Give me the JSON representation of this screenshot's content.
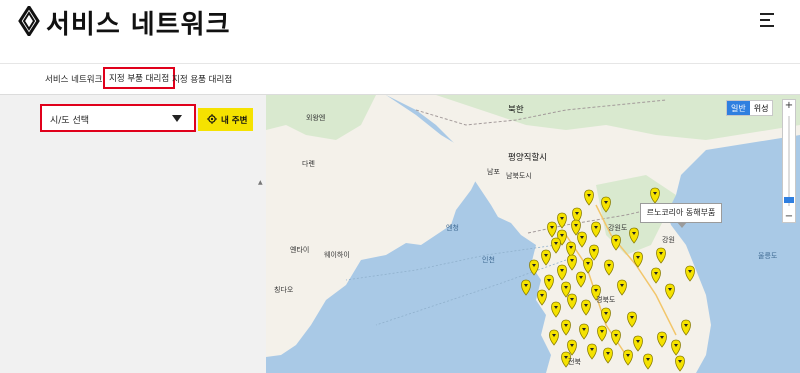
{
  "header": {
    "title": "서비스 네트워크"
  },
  "tabs": [
    {
      "label": "서비스 네트워크"
    },
    {
      "label": "지정 부품 대리점"
    },
    {
      "label": "지정 용품 대리점"
    }
  ],
  "sidebar": {
    "select_placeholder": "시/도 선택",
    "near_button_label": "내 주변"
  },
  "map": {
    "map_types": [
      "일반",
      "위성"
    ],
    "zoom_in": "+",
    "zoom_out": "−",
    "callout": "르노코리아 동해부품",
    "labels": [
      "북한",
      "평양직할시",
      "남포",
      "남북도시",
      "외왕엔",
      "다롄",
      "옌타이",
      "웨이하이",
      "칭다오",
      "강원도",
      "경북도",
      "전북",
      "강원",
      "울릉도",
      "엔청",
      "인천"
    ]
  },
  "colors": {
    "accent_red": "#e0001b",
    "brand_yellow": "#f5e200",
    "map_water": "#a9c9e6",
    "map_land": "#f4f1ea"
  }
}
